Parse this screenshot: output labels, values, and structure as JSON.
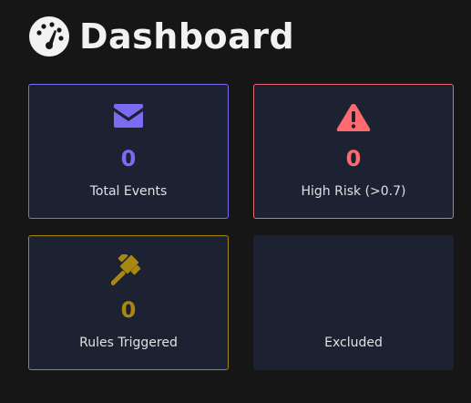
{
  "header": {
    "title": "Dashboard",
    "icon": "tachometer-icon"
  },
  "cards": {
    "total_events": {
      "icon": "envelope-icon",
      "value": "0",
      "label": "Total Events",
      "color": "#7a6cf2"
    },
    "high_risk": {
      "icon": "warning-triangle-icon",
      "value": "0",
      "label": "High Risk (>0.7)",
      "color": "#ff6b6e"
    },
    "rules_triggered": {
      "icon": "gavel-icon",
      "value": "0",
      "label": "Rules Triggered",
      "color": "#a88810"
    },
    "excluded": {
      "label": "Excluded"
    }
  },
  "colors": {
    "background": "#161616",
    "card_background": "#1d2233"
  }
}
